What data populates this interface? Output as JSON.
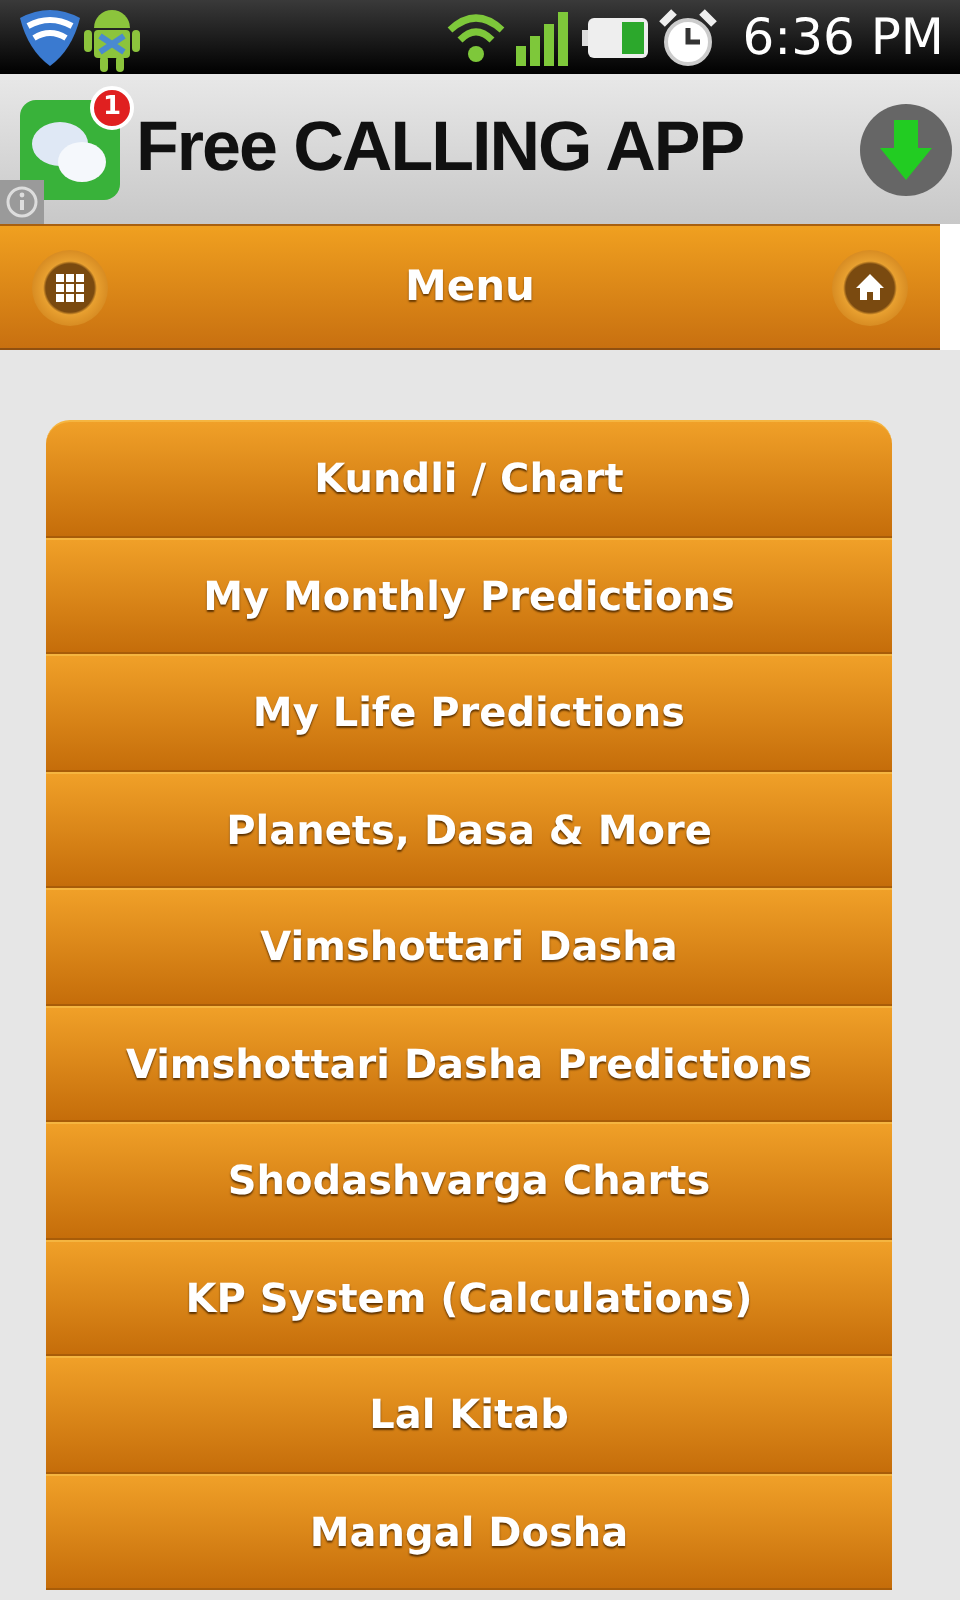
{
  "status_bar": {
    "time": "6:36 PM"
  },
  "ad_banner": {
    "badge": "1",
    "text": "Free CALLING APP"
  },
  "header": {
    "title": "Menu"
  },
  "menu_items": [
    {
      "label": "Kundli / Chart"
    },
    {
      "label": "My Monthly Predictions"
    },
    {
      "label": "My Life Predictions"
    },
    {
      "label": "Planets, Dasa & More"
    },
    {
      "label": "Vimshottari Dasha"
    },
    {
      "label": "Vimshottari Dasha Predictions"
    },
    {
      "label": "Shodashvarga Charts"
    },
    {
      "label": "KP System (Calculations)"
    },
    {
      "label": "Lal Kitab"
    },
    {
      "label": "Mangal Dosha"
    }
  ]
}
